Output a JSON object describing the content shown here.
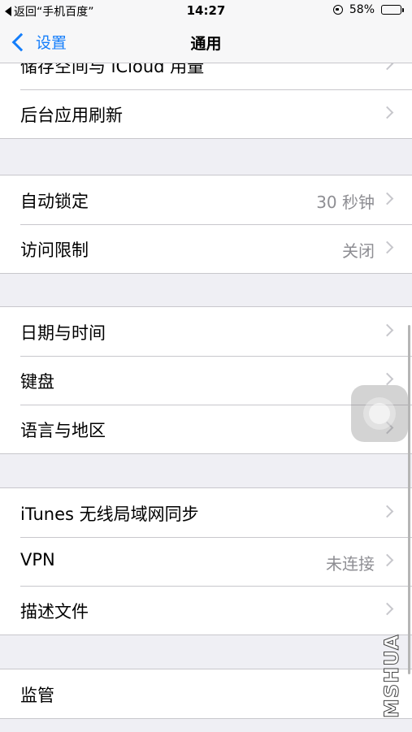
{
  "status_bar": {
    "back_text": "返回“手机百度”",
    "time": "14:27",
    "battery_percent": "58%",
    "battery_level": 0.58,
    "icons": [
      "back-triangle-icon",
      "rotation-lock-icon",
      "battery-icon"
    ]
  },
  "nav": {
    "back_label": "设置",
    "title": "通用"
  },
  "sections": [
    [
      {
        "label": "储存空间与 iCloud 用量",
        "value": ""
      },
      {
        "label": "后台应用刷新",
        "value": ""
      }
    ],
    [
      {
        "label": "自动锁定",
        "value": "30 秒钟"
      },
      {
        "label": "访问限制",
        "value": "关闭"
      }
    ],
    [
      {
        "label": "日期与时间",
        "value": ""
      },
      {
        "label": "键盘",
        "value": ""
      },
      {
        "label": "语言与地区",
        "value": ""
      }
    ],
    [
      {
        "label": "iTunes 无线局域网同步",
        "value": ""
      },
      {
        "label": "VPN",
        "value": "未连接"
      },
      {
        "label": "描述文件",
        "value": ""
      }
    ],
    [
      {
        "label": "监管",
        "value": ""
      }
    ]
  ],
  "watermark": "MSHUA",
  "colors": {
    "accent": "#147efb",
    "background": "#efeff4",
    "separator": "#c8c7cc",
    "value_text": "#8e8e93"
  }
}
